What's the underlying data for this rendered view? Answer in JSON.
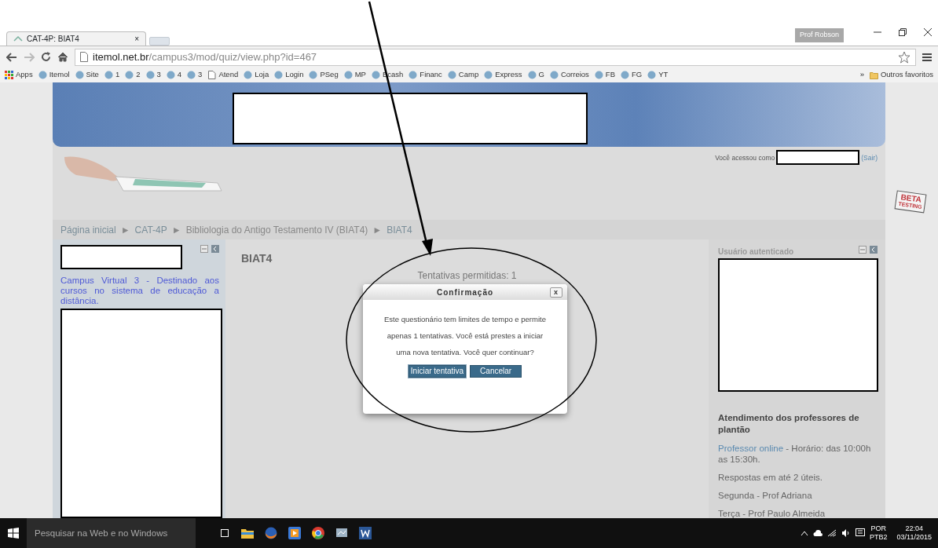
{
  "browser": {
    "tab_title": "CAT-4P: BIAT4",
    "tab_close": "×",
    "profile": "Prof Robson",
    "url_host": "itemol.net.br",
    "url_path": "/campus3/mod/quiz/view.php?id=467",
    "bookmarks": [
      {
        "label": "Apps",
        "kind": "grid"
      },
      {
        "label": "Itemol",
        "kind": "site"
      },
      {
        "label": "Site",
        "kind": "site"
      },
      {
        "label": "1",
        "kind": "site"
      },
      {
        "label": "2",
        "kind": "site"
      },
      {
        "label": "3",
        "kind": "site"
      },
      {
        "label": "4",
        "kind": "site"
      },
      {
        "label": "3",
        "kind": "site"
      },
      {
        "label": "Atend",
        "kind": "page"
      },
      {
        "label": "Loja",
        "kind": "site"
      },
      {
        "label": "Login",
        "kind": "site"
      },
      {
        "label": "PSeg",
        "kind": "site"
      },
      {
        "label": "MP",
        "kind": "site"
      },
      {
        "label": "Bcash",
        "kind": "site"
      },
      {
        "label": "Financ",
        "kind": "site"
      },
      {
        "label": "Camp",
        "kind": "site"
      },
      {
        "label": "Express",
        "kind": "site"
      },
      {
        "label": "G",
        "kind": "site"
      },
      {
        "label": "Correios",
        "kind": "site"
      },
      {
        "label": "FB",
        "kind": "site"
      },
      {
        "label": "FG",
        "kind": "site"
      },
      {
        "label": "YT",
        "kind": "site"
      },
      {
        "label": "»",
        "kind": "more"
      },
      {
        "label": "Outros favoritos",
        "kind": "folder"
      }
    ]
  },
  "page": {
    "login_text": "Você acessou como",
    "logout_link": "(Sair)",
    "stamp": [
      "BETA",
      "TESTING"
    ],
    "breadcrumb": {
      "separator": "►",
      "items": [
        "Página inicial",
        "CAT-4P",
        "Bibliologia do Antigo Testamento IV (BIAT4)",
        "BIAT4"
      ]
    },
    "left_block": {
      "description": "Campus Virtual 3 - Destinado aos cursos no sistema de educação a distância."
    },
    "main": {
      "heading": "BIAT4",
      "attempts": "Tentativas permitidas: 1"
    },
    "right_block": {
      "title": "Usuário autenticado",
      "heading": "Atendimento dos professores de plantão",
      "paragraphs": [
        {
          "link": "Professor online",
          "text": " - Horário: das 10:00h as 15:30h."
        },
        {
          "text": "Respostas em até 2 úteis."
        },
        {
          "text": "Segunda - Prof Adriana"
        },
        {
          "text": "Terça - Prof Paulo Almeida"
        }
      ]
    }
  },
  "dialog": {
    "title": "Confirmação",
    "close": "x",
    "message": "Este questionário tem limites de tempo e permite apenas 1 tentativas. Você está prestes a iniciar uma nova tentativa. Você quer continuar?",
    "buttons": [
      {
        "label": "Iniciar tentativa",
        "selected": true
      },
      {
        "label": "Cancelar",
        "selected": false
      }
    ]
  },
  "taskbar": {
    "search_placeholder": "Pesquisar na Web e no Windows",
    "language": [
      "POR",
      "PTB2"
    ],
    "time": "22:04",
    "date": "03/11/2015"
  }
}
